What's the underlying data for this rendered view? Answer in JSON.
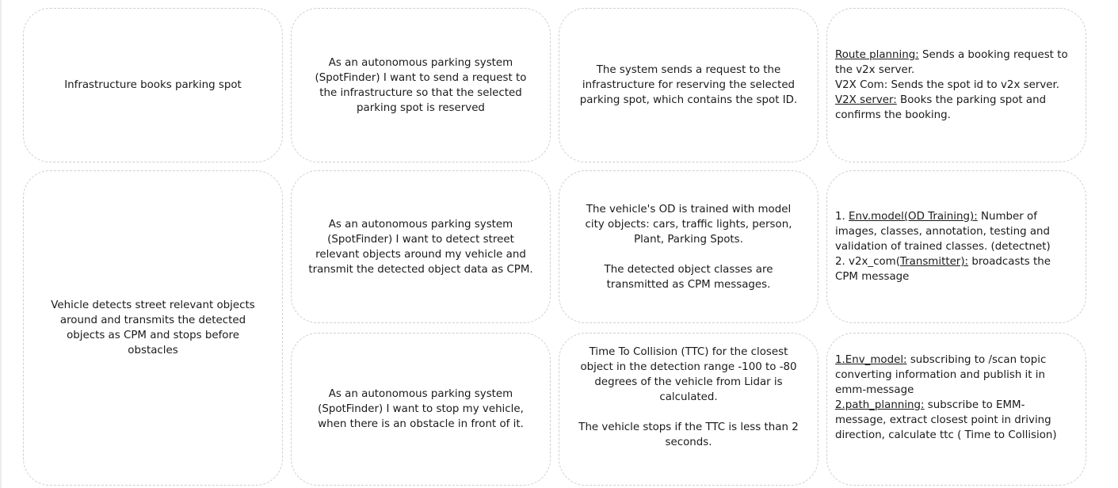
{
  "rows": [
    {
      "epic": "Infrastructure books parking spot",
      "story": "As an autonomous parking system (SpotFinder) I want to send a request to the infrastructure so that the selected parking spot is reserved",
      "description": [
        "The system sends a request to the infrastructure for reserving the selected parking spot, which contains the spot ID."
      ],
      "implementation": [
        {
          "label": "Route planning:",
          "text": " Sends a booking request to the v2x server."
        },
        {
          "label": "",
          "text": "V2X Com: Sends the spot id to v2x server."
        },
        {
          "label": "V2X server:",
          "text": " Books the parking spot and confirms the booking."
        }
      ]
    },
    {
      "epic": "Vehicle detects street relevant objects around and transmits the detected objects as CPM and stops before obstacles",
      "story": "As an autonomous parking system (SpotFinder) I want to detect street relevant objects around my vehicle and transmit the detected object data as CPM.",
      "description": [
        "The vehicle's OD is trained with model city objects: cars, traffic lights, person, Plant, Parking Spots.",
        "The detected object classes are transmitted as CPM messages."
      ],
      "implementation": [
        {
          "prefix": "1. ",
          "label": "Env.model(OD Training):",
          "text": " Number of images, classes, annotation, testing and validation of trained classes. (detectnet)"
        },
        {
          "prefix": "2. v2x_com(",
          "label": "Transmitter):",
          "text": " broadcasts the CPM message"
        }
      ]
    },
    {
      "story": "As an autonomous parking system (SpotFinder) I want to stop my vehicle, when there is an obstacle in front of it.",
      "description": [
        "Time To Collision (TTC) for the closest object in the detection range -100 to -80 degrees of the vehicle from Lidar is calculated.",
        "The vehicle stops if the TTC is less than 2 seconds."
      ],
      "implementation": [
        {
          "label": "1.Env_model:",
          "text": " subscribing to /scan topic converting information and publish it in emm-message"
        },
        {
          "label": "2.path_planning:",
          "text": " subscribe to EMM-message, extract closest point in driving direction, calculate ttc ( Time to Collision)"
        }
      ]
    }
  ]
}
